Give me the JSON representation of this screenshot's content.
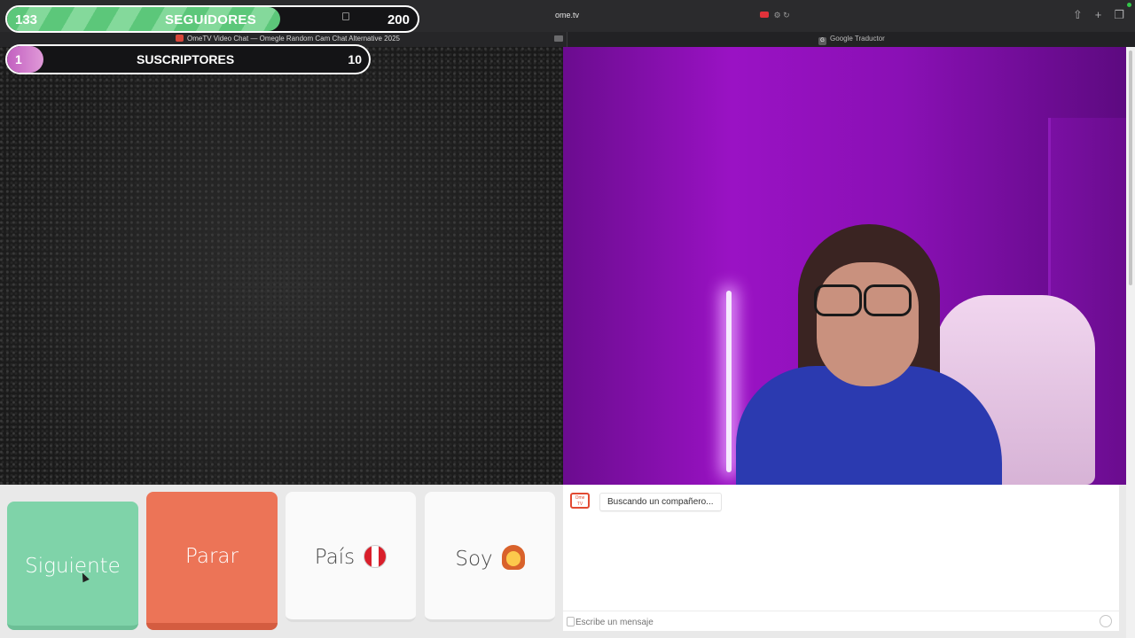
{
  "browser": {
    "url": "ome.tv",
    "tabs": [
      {
        "label": "OmeTV Video Chat — Omegle Random Cam Chat Alternative 2025"
      },
      {
        "label": "Google Traductor"
      }
    ]
  },
  "overlay": {
    "followers": {
      "count": "133",
      "label": "SEGUIDORES",
      "goal": "200",
      "progress": 0.665,
      "color": "#5cc77a"
    },
    "subscribers": {
      "count": "1",
      "label": "SUSCRIPTORES",
      "goal": "10",
      "progress": 0.1,
      "color": "#c25fc0"
    }
  },
  "controls": {
    "next_label": "Siguiente",
    "stop_label": "Parar",
    "country_label": "País",
    "country_flag_icon": "peru-flag-icon",
    "gender_label": "Soy",
    "gender_icon": "woman-emoji-icon"
  },
  "chat": {
    "status_message": "Buscando un compañero...",
    "input_placeholder": "Escribe un mensaje"
  },
  "colors": {
    "next": "#7fd3a9",
    "stop": "#ec7457",
    "accent_red": "#e24a32"
  }
}
